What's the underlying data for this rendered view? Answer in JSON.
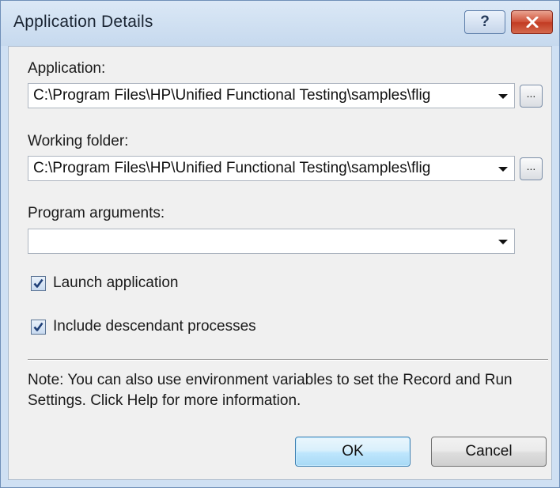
{
  "window": {
    "title": "Application Details",
    "help_label": "?"
  },
  "application": {
    "label": "Application:",
    "value": "C:\\Program Files\\HP\\Unified Functional Testing\\samples\\flig",
    "browse_label": "..."
  },
  "working_folder": {
    "label": "Working folder:",
    "value": "C:\\Program Files\\HP\\Unified Functional Testing\\samples\\flig",
    "browse_label": "..."
  },
  "program_arguments": {
    "label": "Program arguments:",
    "value": ""
  },
  "options": {
    "launch_application": {
      "label": "Launch application",
      "checked": true
    },
    "include_descendants": {
      "label": "Include descendant processes",
      "checked": true
    }
  },
  "note": "Note: You can also use environment variables to set the Record and Run Settings. Click Help for more information.",
  "buttons": {
    "ok": "OK",
    "cancel": "Cancel"
  },
  "colors": {
    "titlebar": "#c6d9ee",
    "close_button": "#c23b22",
    "dialog_background": "#f0f0f0",
    "default_button": "#bee6fd"
  }
}
